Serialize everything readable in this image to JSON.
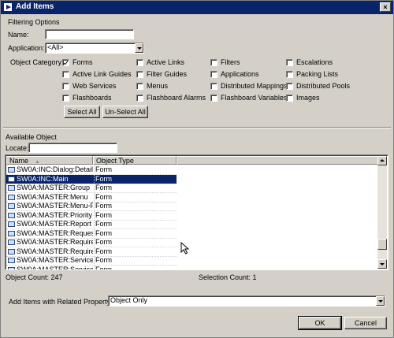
{
  "window": {
    "title": "Add Items",
    "close_glyph": "×"
  },
  "filtering": {
    "heading": "Filtering Options",
    "name_label": "Name:",
    "name_value": "",
    "application_label": "Application:",
    "application_value": "<All>",
    "object_category_label": "Object Category:",
    "categories": [
      {
        "label": "Forms",
        "checked": true
      },
      {
        "label": "Active Links",
        "checked": false
      },
      {
        "label": "Filters",
        "checked": false
      },
      {
        "label": "Escalations",
        "checked": false
      },
      {
        "label": "Active Link Guides",
        "checked": false
      },
      {
        "label": "Filter Guides",
        "checked": false
      },
      {
        "label": "Applications",
        "checked": false
      },
      {
        "label": "Packing Lists",
        "checked": false
      },
      {
        "label": "Web Services",
        "checked": false
      },
      {
        "label": "Menus",
        "checked": false
      },
      {
        "label": "Distributed Mappings",
        "checked": false
      },
      {
        "label": "Distributed Pools",
        "checked": false
      },
      {
        "label": "Flashboards",
        "checked": false
      },
      {
        "label": "Flashboard Alarms",
        "checked": false
      },
      {
        "label": "Flashboard Variables",
        "checked": false
      },
      {
        "label": "Images",
        "checked": false
      }
    ],
    "select_all_label": "Select All",
    "unselect_all_label": "Un-Select All"
  },
  "available": {
    "heading": "Available Object",
    "locate_label": "Locate:",
    "locate_value": "",
    "columns": [
      "Name",
      "Object Type"
    ],
    "sort_glyph": "▲",
    "rows": [
      {
        "name": "SW0A:INC:Dialog:Detail...",
        "type": "Form"
      },
      {
        "name": "SW0A:INC:Main",
        "type": "Form",
        "selected": true
      },
      {
        "name": "SW0A:MASTER:Group",
        "type": "Form"
      },
      {
        "name": "SW0A:MASTER:Menu",
        "type": "Form"
      },
      {
        "name": "SW0A:MASTER:Menu-F...",
        "type": "Form"
      },
      {
        "name": "SW0A:MASTER:Priority",
        "type": "Form"
      },
      {
        "name": "SW0A:MASTER:Report",
        "type": "Form"
      },
      {
        "name": "SW0A:MASTER:Reques...",
        "type": "Form"
      },
      {
        "name": "SW0A:MASTER:Require...",
        "type": "Form"
      },
      {
        "name": "SW0A:MASTER:Require...",
        "type": "Form"
      },
      {
        "name": "SW0A:MASTER:Service",
        "type": "Form"
      },
      {
        "name": "SW0A:MASTER:Service...",
        "type": "Form"
      }
    ],
    "object_count": "Object Count: 247",
    "selection_count": "Selection Count: 1"
  },
  "related": {
    "label": "Add Items with Related Property:",
    "value": "Object Only"
  },
  "buttons": {
    "ok": "OK",
    "cancel": "Cancel"
  }
}
